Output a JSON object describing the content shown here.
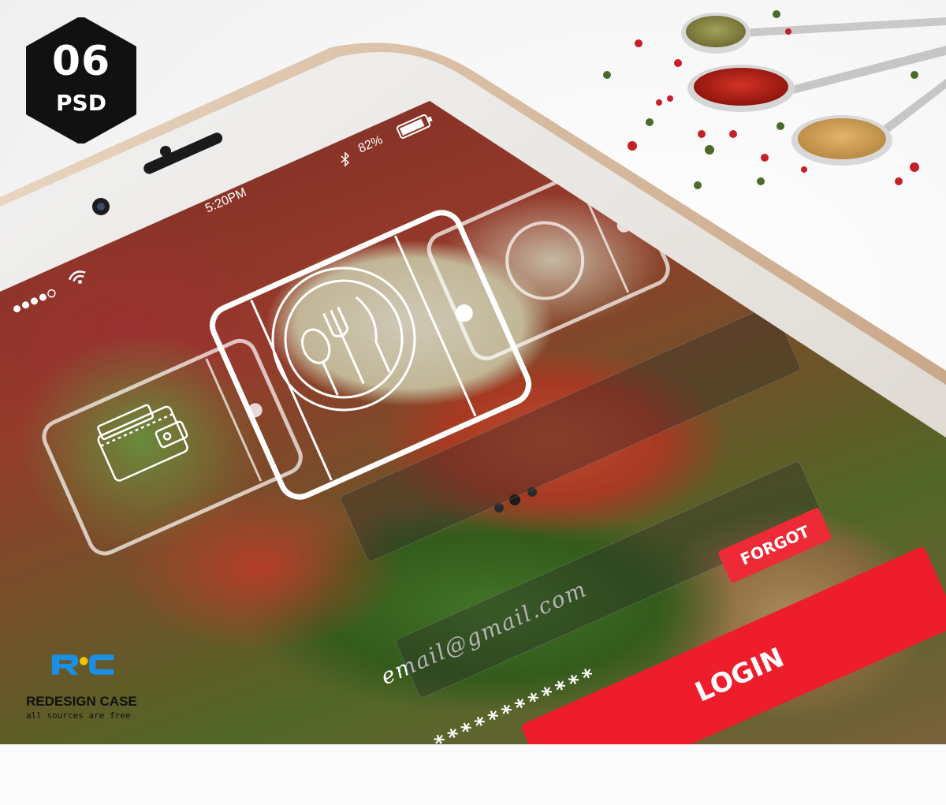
{
  "badge": {
    "number": "06",
    "label": "PSD"
  },
  "status_bar": {
    "time": "5:20PM",
    "battery": "82%"
  },
  "login": {
    "email_value": "email@gmail.com",
    "password_value": "************",
    "forgot_label": "FORGOT",
    "login_label": "LOGIN"
  },
  "brand": {
    "name": "REDESIGN CASE",
    "tagline": "all sources are free"
  },
  "colors": {
    "accent": "#ee1d2b",
    "badge_bg": "#111111",
    "logo_blue": "#1a8fe3",
    "logo_yellow": "#f5c400"
  },
  "icons": [
    "plate-cutlery-icon",
    "wallet-icon",
    "wifi-icon",
    "battery-icon",
    "bluetooth-icon"
  ]
}
